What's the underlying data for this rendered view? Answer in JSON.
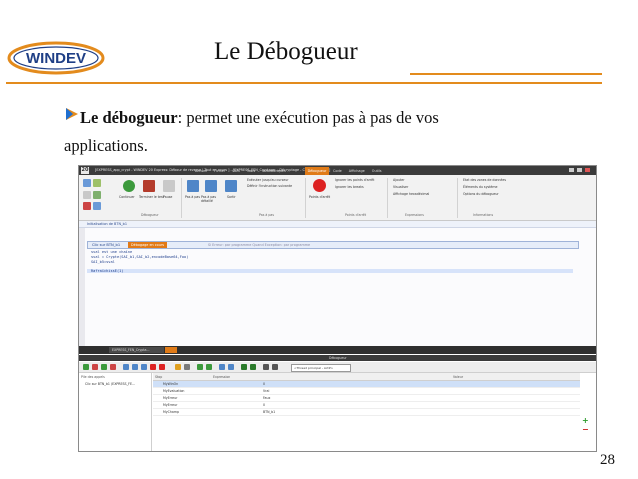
{
  "slide": {
    "title": "Le Débogueur",
    "bullet_bold": "Le débogueur",
    "bullet_rest": ": permet une exécution pas à pas de vos",
    "bullet_line2": "applications.",
    "page_number": "28",
    "logo_text": "WINDEV",
    "accent_color": "#e38b1d"
  },
  "screenshot": {
    "window_title": "[EXPRESS_app_crypt - WINDEV 20 Express: Débour de reverse | Tout en cours ] - [EXPRESS_FEN_Cryptage ...Décryptage - Clic sur BTN_b1]",
    "menu_tabs": [
      "Accueil",
      "Fichier",
      "GDS",
      "Tests automatiques",
      "Débogueur",
      "Code",
      "Affichage",
      "Outils"
    ],
    "active_tab": "Débogueur",
    "ribbon": {
      "continue_label": "Continuer",
      "terminate_label": "Terminer le test",
      "pause_label": "Pause",
      "step_label": "Pas à pas",
      "step_detail_label": "Pas à pas détaillé",
      "exit_label": "Sortir",
      "exec_to_cursor": "Exécuter jusqu'au curseur",
      "define_next": "Définir l'instruction suivante",
      "breakpoint_label": "Points d'arrêt",
      "ignore_breakpoints": "Ignorer les points d'arrêt",
      "ignore_breakpoints2": "Ignorer les breaks",
      "add_label": "Ajouter",
      "visualize_label": "Visualiser",
      "hex_display": "Affichage hexadécimal",
      "memory_label": "Etat des zones de données",
      "system_label": "Éléments du système",
      "debugger_opts": "Options du débogueur",
      "group_labels": [
        "Débogueur",
        "Pas à pas",
        "Points d'arrêt",
        "Expressions",
        "Informations"
      ]
    },
    "code": {
      "init_bar": "Initialisation de BTN_b1",
      "event_label": "Clic sur BTN_b1",
      "status_chip": "Débogage en cours",
      "event_hint": "Si Erreur: par programme   Quand Exception: par programme",
      "lines": [
        "sval est une chaîne",
        "sval = Crypte(SAI_b1,SAI_b2,encodeBase64,Foo)",
        "SAI_b5=sval",
        "",
        "RafraîchissE(1)"
      ]
    },
    "bottom": {
      "tab_label": "EXPRESS_FEN_Crypta...",
      "panel_title": "Débogueur",
      "thread_combo": "<Thread principal - Actif>",
      "stack_header": "Pile des appels",
      "stack_row": "Clic sur BTN_b1 (EXPRESS_FE...",
      "watch_headers": [
        "Stop",
        "Expression",
        "Valeur"
      ],
      "watch_rows": [
        [
          "MyWinOn",
          "0"
        ],
        [
          "MyEvaluation",
          "Vrai"
        ],
        [
          "MyErreur",
          "Faux"
        ],
        [
          "MyErreur",
          "0"
        ],
        [
          "MyChamp",
          "BTN_b1"
        ]
      ]
    }
  }
}
